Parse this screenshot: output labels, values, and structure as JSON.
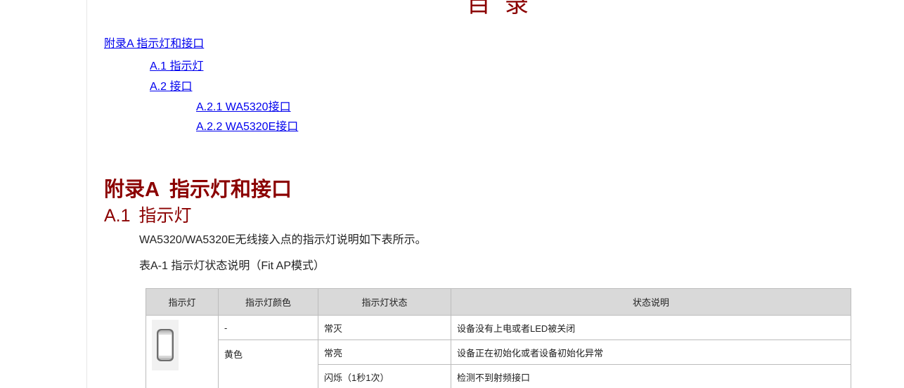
{
  "toc": {
    "title": "目录",
    "items": [
      {
        "label": "附录A 指示灯和接口"
      },
      {
        "label": "A.1 指示灯"
      },
      {
        "label": "A.2 接口"
      },
      {
        "label": "A.2.1 WA5320接口"
      },
      {
        "label": "A.2.2 WA5320E接口"
      }
    ]
  },
  "appendix": {
    "number": "附录A",
    "title": "指示灯和接口"
  },
  "section": {
    "number": "A.1",
    "title": "指示灯"
  },
  "intro": "WA5320/WA5320E无线接入点的指示灯说明如下表所示。",
  "table_caption": "表A-1 指示灯状态说明（Fit AP模式）",
  "table": {
    "headers": [
      "指示灯",
      "指示灯颜色",
      "指示灯状态",
      "状态说明"
    ],
    "icon": "led-indicator-icon",
    "rows": [
      {
        "color": "-",
        "state": "常灭",
        "desc": "设备没有上电或者LED被关闭"
      },
      {
        "color": "黄色",
        "state": "常亮",
        "desc": "设备正在初始化或者设备初始化异常"
      },
      {
        "color": "",
        "state": "闪烁（1秒1次）",
        "desc": "检测不到射频接口"
      }
    ]
  },
  "colors": {
    "heading": "#8b0000",
    "link": "#0000ee",
    "table_header_bg": "#d9d9d9"
  }
}
